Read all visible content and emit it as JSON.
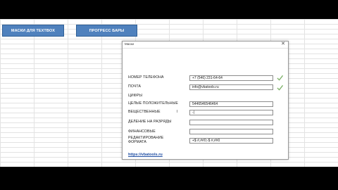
{
  "sheet": {
    "buttons": {
      "masks": "МАСКИ ДЛЯ TEXTBOX",
      "progress": "ПРОГРЕСС БАРЫ"
    }
  },
  "dialog": {
    "title": "Маски",
    "close": "✕",
    "rows": {
      "phone": {
        "label": "НОМЕР ТЕЛЕФОНА",
        "value": "+7 (546) 231-64-64",
        "valid": true
      },
      "email": {
        "label": "ПОЧТА",
        "value": "info@vbatools.ru",
        "valid": true
      },
      "digits_heading": "ЦИФРЫ",
      "integers": {
        "label": "ЦЕЛЫЕ ПОЛОЖИТЕЛЬНЫЕ",
        "value": "5446546546464"
      },
      "real": {
        "label": "ВЕЩЕСТВЕННЫЕ",
        "value": "-|"
      },
      "thousands": {
        "label": "ДЕЛЕНИЕ НА РАЗРЯДЫ",
        "value": ""
      },
      "financial": {
        "label": "ФИНАНСОВЫЕ",
        "value": ""
      },
      "format_edit": {
        "label_line1": "РЕДАКТИРОВАНИЕ",
        "label_line2": "ФОРМАТА",
        "value": "+$ #,##0;-$ #,##0"
      }
    },
    "link": "https://vbatools.ru",
    "icons": {
      "valid": "checkmark-icon",
      "close": "close-icon"
    },
    "colors": {
      "check": "#7fb26a",
      "link": "#1f4ea3",
      "button": "#4f81bd"
    }
  }
}
